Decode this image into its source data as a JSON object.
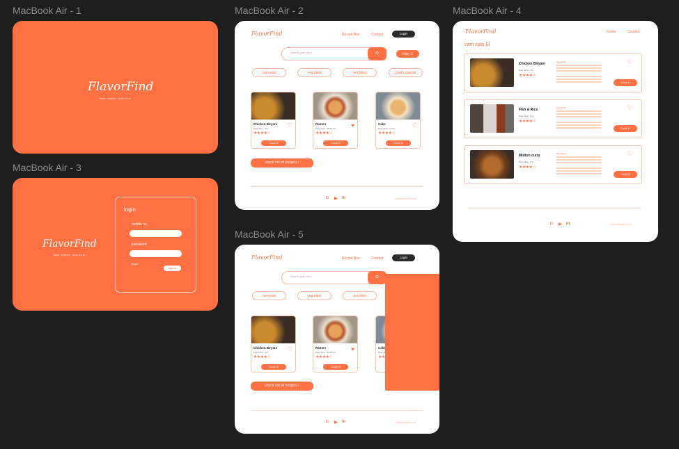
{
  "frames": {
    "f1": "MacBook Air - 1",
    "f2": "MacBook Air - 2",
    "f3": "MacBook Air - 3",
    "f4": "MacBook Air - 4",
    "f5": "MacBook Air - 5"
  },
  "brand": {
    "name": "FlavorFind",
    "tagline": "Taste, explore, cook-it-fun"
  },
  "login": {
    "title": "login",
    "mobile_label": "mobile no.",
    "password_label": "password",
    "forgot": "forgot",
    "signin": "sign in"
  },
  "nav": {
    "recipe_box": "Recipe Box",
    "contact": "Contact",
    "login": "Login",
    "home": "Home"
  },
  "search": {
    "placeholder": "Search your food",
    "filter": "Filter ☰"
  },
  "chips": [
    "cam eats",
    "veg plate",
    "sea bites",
    "chef's special"
  ],
  "cards": [
    {
      "name": "Chicken Biryani",
      "prep": "Prep Time : 3 hr",
      "stars": "★★★★☆",
      "heart": "♡"
    },
    {
      "name": "Ramen",
      "prep": "Prep Time : 30-45 min",
      "stars": "★★★★☆",
      "heart": "♥"
    },
    {
      "name": "Cake",
      "prep": "Prep Time : 2-3 hr",
      "stars": "★★★★☆",
      "heart": "♡"
    }
  ],
  "cook": "Cook it!",
  "more": "check out all recipe's  ›",
  "social": [
    "◘",
    "▶",
    "in"
  ],
  "email": "info@flavorfind.com",
  "cam": {
    "title": "cam eats ⊟",
    "ingredients": "Ingredients",
    "rows": [
      {
        "name": "Chicken Biryani",
        "prep": "Prep Time : 3 hr",
        "stars": "★★★★☆"
      },
      {
        "name": "Fish & Rice",
        "prep": "Prep Time : 1 hr",
        "stars": "★★★★☆"
      },
      {
        "name": "Mutton curry",
        "prep": "Prep Time : 2 hr",
        "stars": "★★★★☆"
      }
    ]
  },
  "colors": {
    "accent": "#ff7043",
    "dark": "#2b2b2b",
    "background": "#1e1e1e"
  }
}
